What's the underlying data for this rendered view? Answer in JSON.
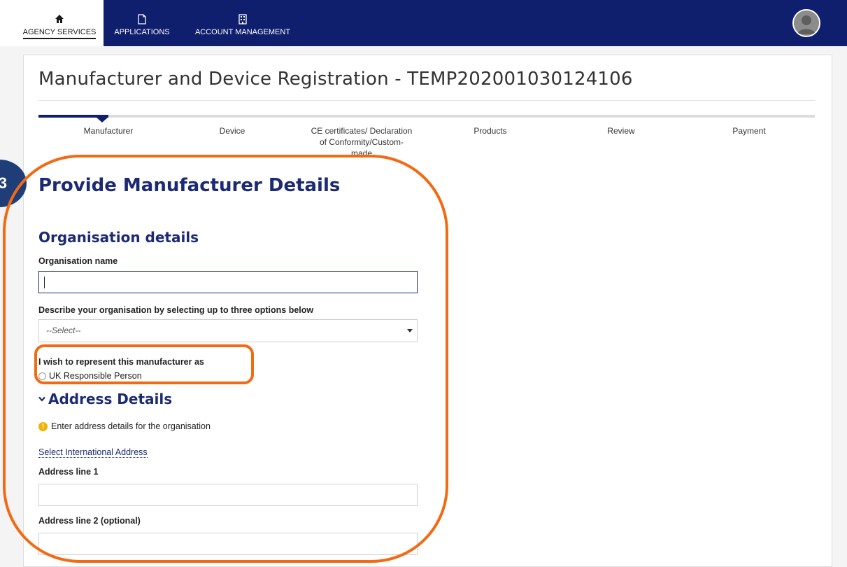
{
  "nav": {
    "items": [
      {
        "label": "AGENCY SERVICES",
        "icon": "home-icon",
        "active": true
      },
      {
        "label": "APPLICATIONS",
        "icon": "document-icon",
        "active": false
      },
      {
        "label": "ACCOUNT MANAGEMENT",
        "icon": "building-icon",
        "active": false
      }
    ],
    "avatar": "user-avatar-icon"
  },
  "page": {
    "title": "Manufacturer and Device Registration - TEMP202001030124106"
  },
  "stepper": {
    "active_step": "Manufacturer",
    "steps": [
      "Manufacturer",
      "Device",
      "CE certificates/ Declaration of Conformity/Custom-made",
      "Products",
      "Review",
      "Payment"
    ]
  },
  "form": {
    "heading": "Provide Manufacturer Details",
    "section_title": "Organisation details",
    "org_name_label": "Organisation name",
    "org_name_value": "",
    "describe_label": "Describe your organisation by selecting up to three options below",
    "describe_select_value": "--Select--",
    "represent_label": "I wish to represent this manufacturer as",
    "represent_option": "UK Responsible Person",
    "address_section_title": "Address Details",
    "address_info": "Enter address details for the organisation",
    "intl_address_link": "Select International Address",
    "address_line1_label": "Address line 1",
    "address_line1_value": "",
    "address_line2_label": "Address line 2 (optional)",
    "address_line2_value": ""
  },
  "annotation": {
    "badge_text": "3",
    "highlight_color": "#f26a12",
    "badge_color": "#1f3e78"
  },
  "colors": {
    "nav_bg": "#0f1f6e",
    "heading": "#1b2a73",
    "warning": "#f0b400"
  }
}
